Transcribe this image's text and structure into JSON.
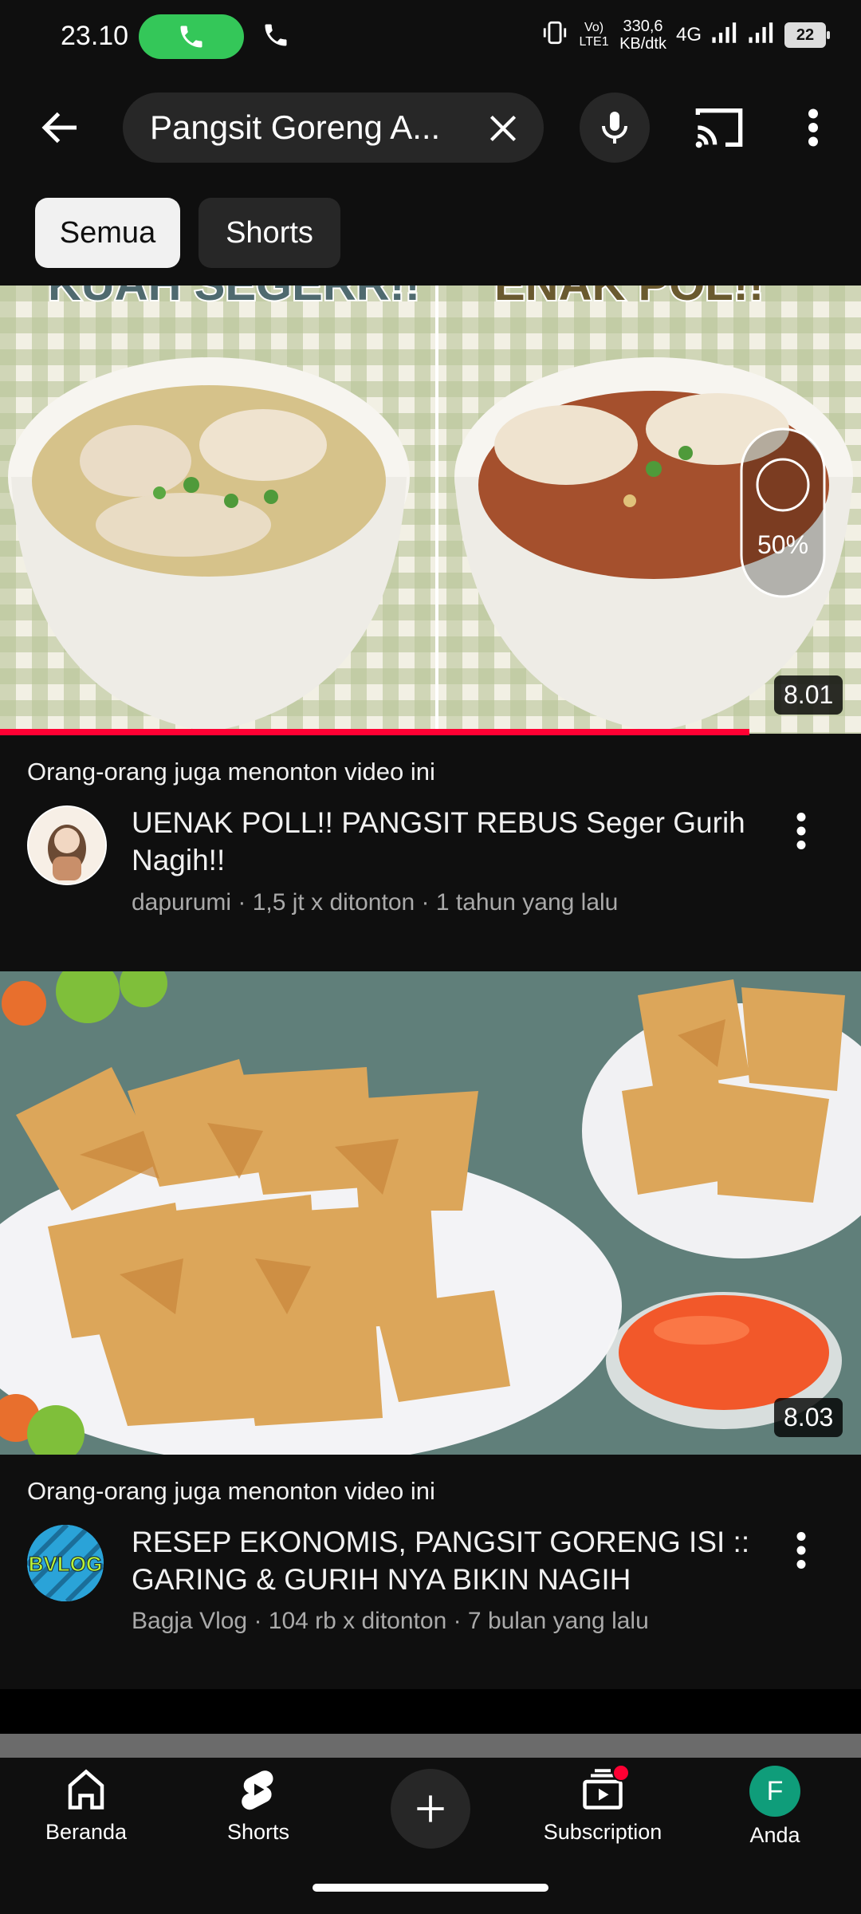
{
  "status": {
    "time": "23.10",
    "network_speed_value": "330,6",
    "network_speed_unit": "KB/dtk",
    "network_type": "4G",
    "volte": "Vo) LTE1",
    "battery": "22"
  },
  "search": {
    "query": "Pangsit Goreng A..."
  },
  "chips": [
    {
      "label": "Semua",
      "selected": true
    },
    {
      "label": "Shorts",
      "selected": false
    }
  ],
  "videos": [
    {
      "thumb_text_left": "KUAH SEGERR!!",
      "thumb_text_right": "ENAK POL!!",
      "badge_percent": "50%",
      "duration": "8.01",
      "watch_progress": 0.87,
      "caption": "Orang-orang juga menonton video ini",
      "title": "UENAK POLL!! PANGSIT REBUS Seger Gurih Nagih!!",
      "channel_meta": "dapurumi · 1,5 jt x ditonton · 1 tahun yang lalu"
    },
    {
      "duration": "8.03",
      "caption": "Orang-orang juga menonton video ini",
      "title": "RESEP EKONOMIS, PANGSIT GORENG ISI  ::  GARING & GURIH NYA BIKIN NAGIH",
      "channel_meta": "Bagja Vlog · 104 rb x ditonton · 7 bulan yang lalu",
      "avatar_text": "BVLOG"
    }
  ],
  "bottom_nav": [
    {
      "label": "Beranda",
      "icon": "home-icon"
    },
    {
      "label": "Shorts",
      "icon": "shorts-icon"
    },
    {
      "label": "",
      "icon": "create-plus-icon"
    },
    {
      "label": "Subscription",
      "icon": "subscriptions-icon"
    },
    {
      "label": "Anda",
      "icon": "profile-avatar",
      "avatar_letter": "F"
    }
  ],
  "colors": {
    "background": "#0f0f0f",
    "accent_red": "#ff0033",
    "call_green": "#34c759",
    "profile_teal": "#0f9d7a"
  }
}
